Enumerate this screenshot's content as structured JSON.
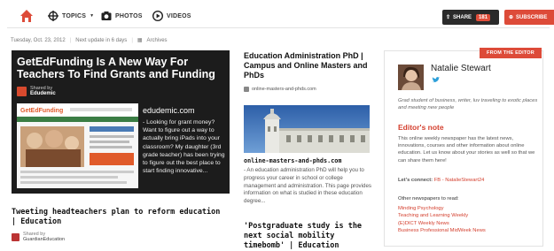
{
  "nav": {
    "topics": "TOPICS",
    "photos": "PHOTOS",
    "videos": "VIDEOS",
    "share_label": "SHARE",
    "share_count": "181",
    "subscribe_label": "SUBSCRIBE"
  },
  "meta": {
    "date": "Tuesday, Oct. 23, 2012",
    "next_update": "Next update in 6 days",
    "archives": "Archives"
  },
  "featured": {
    "title": "GetEdFunding Is A New Way For Teachers To Find Grants and Funding",
    "shared_by": "Shared by",
    "sharer": "Edudemic",
    "source": "edudemic.com",
    "description": "- Looking for grant money? Want to figure out a way to actually bring iPads into your classroom? My daughter (3rd grade teacher) has been trying to figure out the best place to start finding innovative...",
    "thumb_logo": "GetEdFunding"
  },
  "article2": {
    "title": "Tweeting headteachers plan to reform education | Education",
    "shared_by": "Shared by",
    "sharer": "GuardianEducation"
  },
  "mid": {
    "title": "Education Administration PhD | Campus and Online Masters and PhDs",
    "source": "online-masters-and-phds.com",
    "source2": "online-masters-and-phds.com",
    "description": "- An education administration PhD will help you to progress your career in school or college management and administration. This page provides information on what is studied in these education degree...",
    "title2": "'Postgraduate study is the next social mobility timebomb' | Education"
  },
  "editor": {
    "badge": "FROM THE EDITOR",
    "name": "Natalie Stewart",
    "bio": "Grad student of business, writer, luv traveling to exotic places and meeting new people",
    "note_heading": "Editor's note",
    "note": "This online weekly newspaper has the latest news, innovations, courses and other information about online education. Let us know about your stories as well so that we can share them here!",
    "connect_label": "Let's connect:",
    "connect_links": "FB - NatalieStewart24",
    "other_heading": "Other newspapers to read:",
    "links": [
      "Minding Psychology",
      "Teaching and Learning Weekly",
      "(E)DICT Weekly News",
      "Business Professional MidWeek News"
    ]
  },
  "colors": {
    "accent": "#dd4b39",
    "dark": "#1c1c1c",
    "link": "#d4402f"
  }
}
